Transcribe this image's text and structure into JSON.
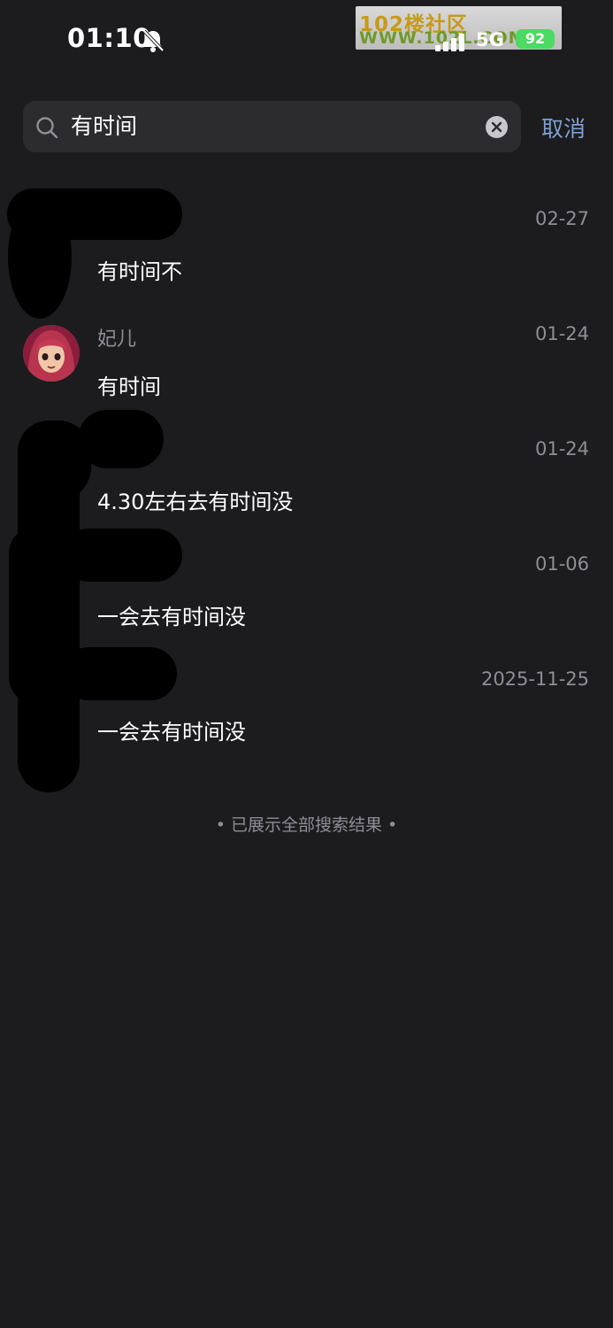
{
  "status_bar": {
    "time": "01:10",
    "network": "5G",
    "battery": "92",
    "watermark_line1": "102楼社区",
    "watermark_line2": "WWW.102L.COM"
  },
  "search": {
    "query": "有时间",
    "cancel_label": "取消"
  },
  "results": [
    {
      "sender": "",
      "date": "02-27",
      "message": "有时间不"
    },
    {
      "sender": "妃儿",
      "date": "01-24",
      "message": "有时间"
    },
    {
      "sender": "",
      "date": "01-24",
      "message": "4.30左右去有时间没"
    },
    {
      "sender": "",
      "date": "01-06",
      "message": "一会去有时间没"
    },
    {
      "sender": "",
      "date": "2025-11-25",
      "message": "一会去有时间没"
    }
  ],
  "end_note": "• 已展示全部搜索结果 •",
  "colors": {
    "background": "#1c1c1e",
    "search_field": "#2c2c2e",
    "accent": "#7f9fd1",
    "secondary_text": "#8e8e93"
  },
  "icons": [
    "bell-slash-icon",
    "signal-icon",
    "battery-icon",
    "search-icon",
    "clear-icon"
  ]
}
